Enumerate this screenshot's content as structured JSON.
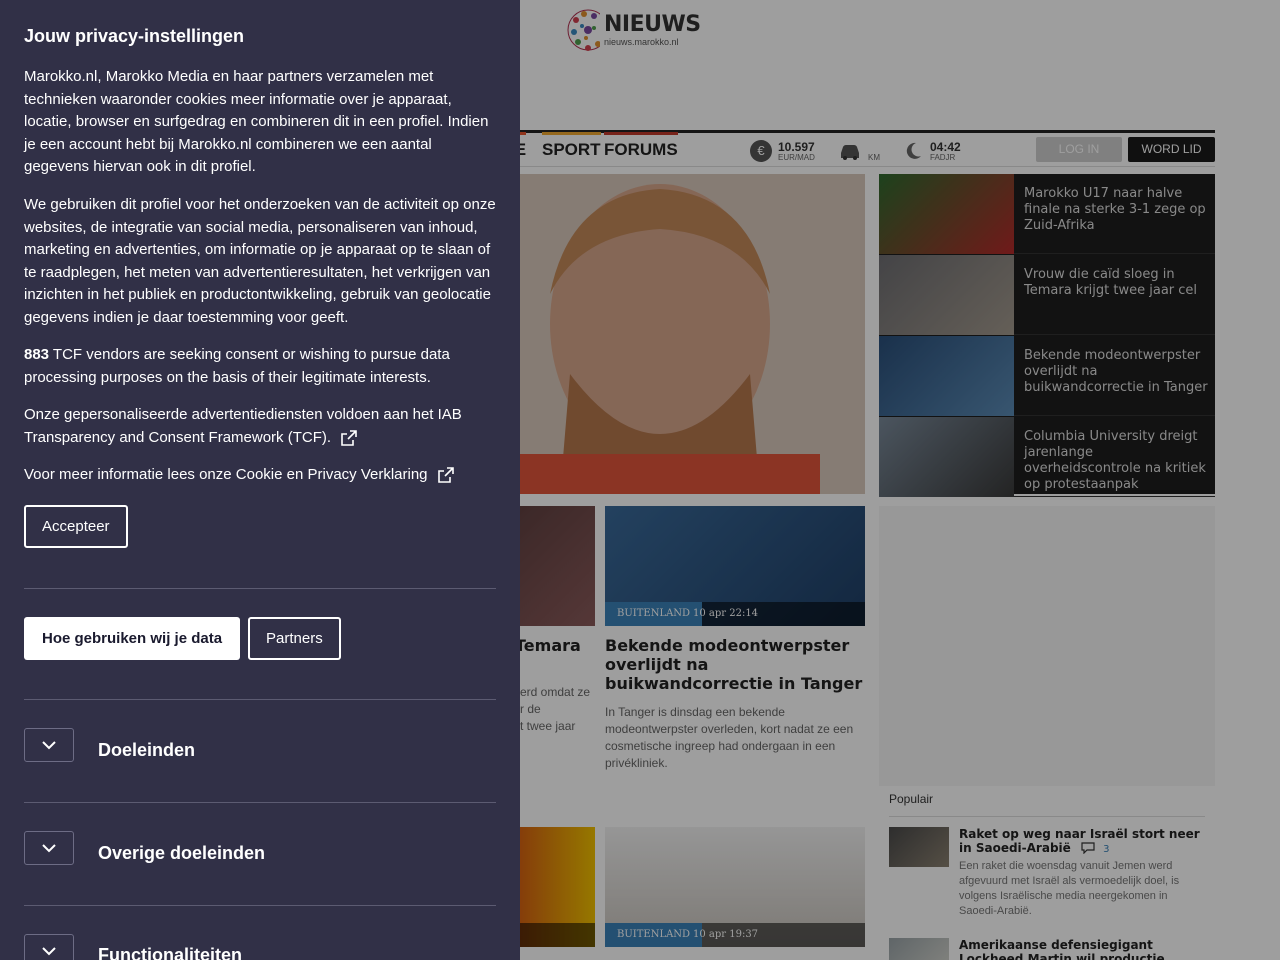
{
  "site": {
    "logo_title": "NIEUWS",
    "logo_sub": "nieuws.marokko.nl",
    "nav": [
      {
        "label": "IE",
        "color": "#e8552d"
      },
      {
        "label": "SPORT",
        "color": "#f0a830"
      },
      {
        "label": "FORUMS",
        "color": "#c0392b"
      }
    ],
    "widgets": {
      "currency_value": "10.597",
      "currency_unit": "EUR/MAD",
      "traffic_unit": "KM",
      "prayer_time": "04:42",
      "prayer_name": "FADJR"
    },
    "login_label": "LOG IN",
    "join_label": "WORD LID",
    "side_news": [
      {
        "title": "Marokko U17 naar halve finale na sterke 3-1 zege op Zuid-Afrika"
      },
      {
        "title": "Vrouw die caïd sloeg in Temara krijgt twee jaar cel"
      },
      {
        "title": "Bekende modeontwerpster overlijdt na buikwandcorrectie in Tanger"
      },
      {
        "title": "Columbia University dreigt jarenlange overheidscontrole na kritiek op protestaanpak"
      }
    ],
    "cards": [
      {
        "partial_title": "Temara",
        "partial_desc": [
          "erd omdat ze",
          "r de",
          "t twee jaar"
        ]
      },
      {
        "tag": "BUITENLAND",
        "date": "10 apr 22:14",
        "title": "Bekende modeontwerpster overlijdt na buikwandcorrectie in Tanger",
        "desc": "In Tanger is dinsdag een bekende modeontwerpster overleden, kort nadat ze een cosmetische ingreep had ondergaan in een privékliniek."
      },
      {
        "tag": "BUITENLAND",
        "date": "10 apr 19:37"
      }
    ],
    "popular_title": "Populair",
    "popular": [
      {
        "title": "Raket op weg naar Israël stort neer in Saoedi-Arabië",
        "comments": "3",
        "text": "Een raket die woensdag vanuit Jemen werd afgevuurd met Israël als vermoedelijk doel, is volgens Israëlische media neergekomen in Saoedi-Arabië."
      },
      {
        "title": "Amerikaanse defensiegigant Lockheed Martin wil productie starten in"
      }
    ]
  },
  "privacy": {
    "title": "Jouw privacy-instellingen",
    "para1": "Marokko.nl, Marokko Media en haar partners verzamelen met technieken waaronder cookies meer informatie over je apparaat, locatie, browser en surfgedrag en combineren dit in een profiel. Indien je een account hebt bij Marokko.nl combineren we een aantal gegevens hiervan ook in dit profiel.",
    "para2": "We gebruiken dit profiel voor het onderzoeken van de activiteit op onze websites, de integratie van social media, personaliseren van inhoud, marketing en advertenties, om informatie op je apparaat op te slaan of te raadplegen, het meten van advertentieresultaten, het verkrijgen van inzichten in het publiek en productontwikkeling, gebruik van geolocatie gegevens indien je daar toestemming voor geeft.",
    "vendor_count": "883",
    "para3": " TCF vendors are seeking consent or wishing to pursue data processing purposes on the basis of their legitimate interests.",
    "para4": "Onze gepersonaliseerde advertentiediensten voldoen aan het IAB Transparency and Consent Framework (TCF).",
    "para5": "Voor meer informatie lees onze Cookie en Privacy Verklaring",
    "accept_label": "Accepteer",
    "how_label": "Hoe gebruiken wij je data",
    "partners_label": "Partners",
    "sections": [
      {
        "label": "Doeleinden"
      },
      {
        "label": "Overige doeleinden"
      },
      {
        "label": "Functionaliteiten"
      }
    ]
  },
  "icons": {
    "external_link": "external-link-icon",
    "chevron": "chevron-down-icon",
    "currency": "euro-icon",
    "traffic": "car-icon",
    "prayer": "crescent-icon",
    "comment": "comment-icon"
  }
}
